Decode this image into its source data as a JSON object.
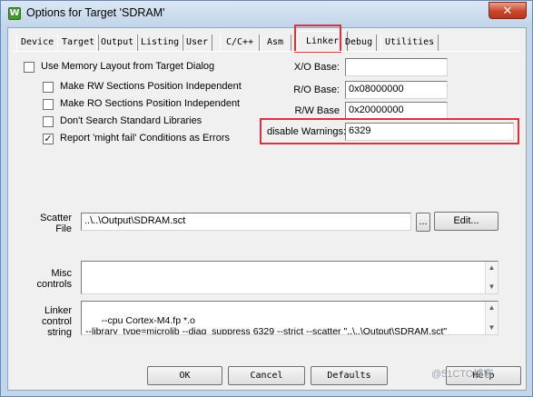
{
  "window": {
    "title": "Options for Target 'SDRAM'",
    "app_icon_letter": "W",
    "close_label": "✕"
  },
  "tabs": [
    {
      "label": "Device"
    },
    {
      "label": "Target"
    },
    {
      "label": "Output"
    },
    {
      "label": "Listing"
    },
    {
      "label": "User"
    },
    {
      "label": "C/C++"
    },
    {
      "label": "Asm"
    },
    {
      "label": "Linker",
      "active": true
    },
    {
      "label": "Debug"
    },
    {
      "label": "Utilities"
    }
  ],
  "options": {
    "use_memory_layout": {
      "label": "Use Memory Layout from Target Dialog",
      "checked": false
    },
    "rw_independent": {
      "label": "Make RW Sections Position Independent",
      "checked": false
    },
    "ro_independent": {
      "label": "Make RO Sections Position Independent",
      "checked": false
    },
    "dont_search_libs": {
      "label": "Don't Search Standard Libraries",
      "checked": false
    },
    "might_fail_errors": {
      "label": "Report 'might fail' Conditions as Errors",
      "checked": true,
      "mark": "✓"
    }
  },
  "fields": {
    "xo_base": {
      "label": "X/O Base:",
      "value": ""
    },
    "ro_base": {
      "label": "R/O Base:",
      "value": "0x08000000"
    },
    "rw_base": {
      "label": "R/W Base",
      "value": "0x20000000"
    },
    "disable_warnings": {
      "label": "disable Warnings:",
      "value": "6329"
    }
  },
  "scatter": {
    "label_line1": "Scatter",
    "label_line2": "File",
    "value": "..\\..\\Output\\SDRAM.sct",
    "browse_label": "...",
    "edit_label": "Edit..."
  },
  "misc": {
    "label_line1": "Misc",
    "label_line2": "controls",
    "value": ""
  },
  "linker_string": {
    "label_line1": "Linker",
    "label_line2": "control",
    "label_line3": "string",
    "value": "--cpu Cortex-M4.fp *.o\n--library_type=microlib --diag_suppress 6329 --strict --scatter \"..\\..\\Output\\SDRAM.sct\""
  },
  "buttons": {
    "ok": "OK",
    "cancel": "Cancel",
    "defaults": "Defaults",
    "help": "Help"
  },
  "scroll_arrows": {
    "up": "▲",
    "down": "▼"
  },
  "watermark": "@51CTO博客"
}
